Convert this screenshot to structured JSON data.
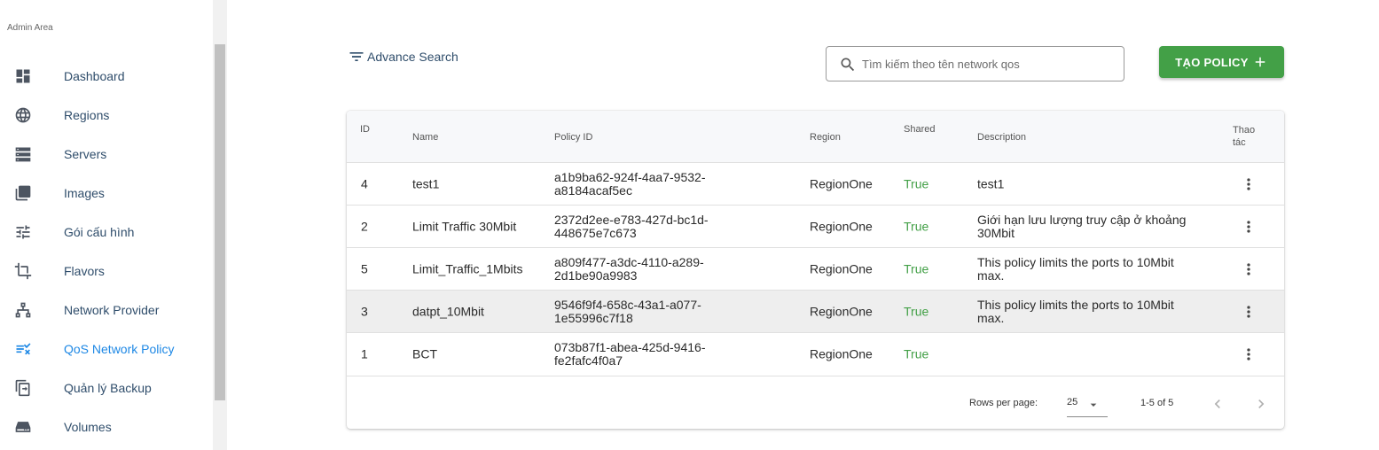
{
  "sidebar": {
    "header": "Admin Area",
    "items": [
      {
        "label": "Dashboard",
        "icon": "dashboard-icon"
      },
      {
        "label": "Regions",
        "icon": "globe-icon"
      },
      {
        "label": "Servers",
        "icon": "servers-icon"
      },
      {
        "label": "Images",
        "icon": "images-icon"
      },
      {
        "label": "Gói cấu hình",
        "icon": "tune-icon"
      },
      {
        "label": "Flavors",
        "icon": "crop-icon"
      },
      {
        "label": "Network Provider",
        "icon": "network-icon"
      },
      {
        "label": "QoS Network Policy",
        "icon": "policy-checklist-icon",
        "active": true
      },
      {
        "label": "Quản lý Backup",
        "icon": "backup-icon"
      },
      {
        "label": "Volumes",
        "icon": "storage-icon"
      }
    ]
  },
  "toolbar": {
    "advance_search_label": "Advance Search",
    "search_placeholder": "Tìm kiếm theo tên network qos",
    "search_value": "",
    "create_label": "TẠO POLICY",
    "accent_color": "#43a047"
  },
  "table": {
    "headers": {
      "id": "ID",
      "name": "Name",
      "policy_id": "Policy ID",
      "region": "Region",
      "shared": "Shared",
      "description": "Description",
      "actions_line1": "Thao",
      "actions_line2": "tác"
    },
    "rows": [
      {
        "id": "4",
        "name": "test1",
        "policy_id_1": "a1b9ba62-924f-4aa7-9532-",
        "policy_id_2": "a8184acaf5ec",
        "region": "RegionOne",
        "shared": "True",
        "desc_1": "test1",
        "desc_2": ""
      },
      {
        "id": "2",
        "name": "Limit Traffic 30Mbit",
        "policy_id_1": "2372d2ee-e783-427d-bc1d-",
        "policy_id_2": "448675e7c673",
        "region": "RegionOne",
        "shared": "True",
        "desc_1": "Giới hạn lưu lượng truy cập ở khoảng",
        "desc_2": "30Mbit"
      },
      {
        "id": "5",
        "name": "Limit_Traffic_1Mbits",
        "policy_id_1": "a809f477-a3dc-4110-a289-",
        "policy_id_2": "2d1be90a9983",
        "region": "RegionOne",
        "shared": "True",
        "desc_1": "This policy limits the ports to 10Mbit",
        "desc_2": "max."
      },
      {
        "id": "3",
        "name": "datpt_10Mbit",
        "policy_id_1": "9546f9f4-658c-43a1-a077-",
        "policy_id_2": "1e55996c7f18",
        "region": "RegionOne",
        "shared": "True",
        "desc_1": "This policy limits the ports to 10Mbit",
        "desc_2": "max."
      },
      {
        "id": "1",
        "name": "BCT",
        "policy_id_1": "073b87f1-abea-425d-9416-",
        "policy_id_2": "fe2fafc4f0a7",
        "region": "RegionOne",
        "shared": "True",
        "desc_1": "",
        "desc_2": ""
      }
    ],
    "shared_color": "#43a047"
  },
  "pagination": {
    "rows_per_page_label": "Rows per page:",
    "rows_per_page_value": "25",
    "range_label": "1-5 of 5"
  }
}
